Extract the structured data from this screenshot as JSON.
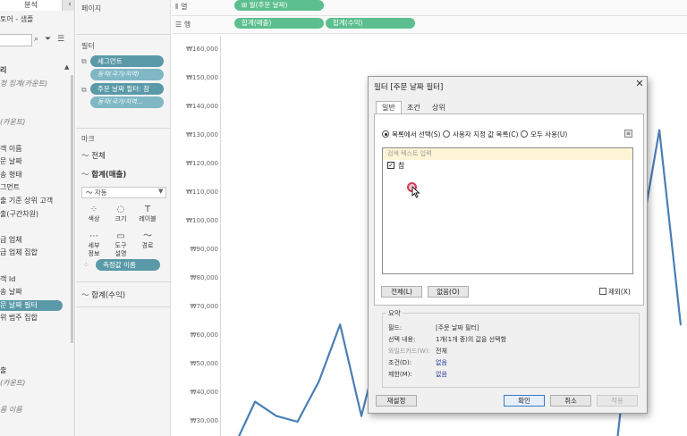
{
  "left_pane": {
    "tab_label": "분석",
    "collapse_icon": "chevron-left-icon",
    "datasource": "토어 - 샘플",
    "fields": [
      {
        "label": "리",
        "style": "bold"
      },
      {
        "label": "정 집계(카운트)",
        "style": "italic"
      },
      {
        "label": "",
        "style": ""
      },
      {
        "label": "",
        "style": ""
      },
      {
        "label": "(카운트)",
        "style": "italic"
      },
      {
        "label": "",
        "style": ""
      },
      {
        "label": "객 이름",
        "style": ""
      },
      {
        "label": "문 날짜",
        "style": ""
      },
      {
        "label": "송 형태",
        "style": ""
      },
      {
        "label": "그먼트",
        "style": ""
      },
      {
        "label": "출 기준 상위 고객",
        "style": ""
      },
      {
        "label": "출(구간차원)",
        "style": ""
      },
      {
        "label": "",
        "style": ""
      },
      {
        "label": "급 업체",
        "style": ""
      },
      {
        "label": "급 업체 집합",
        "style": ""
      },
      {
        "label": "",
        "style": ""
      },
      {
        "label": "객 Id",
        "style": ""
      },
      {
        "label": "송 날짜",
        "style": ""
      },
      {
        "label": "문 날짜 필터",
        "style": "selected"
      },
      {
        "label": "위 범주 집합",
        "style": ""
      },
      {
        "label": "",
        "style": ""
      },
      {
        "label": "",
        "style": ""
      },
      {
        "label": "",
        "style": ""
      },
      {
        "label": "출",
        "style": ""
      },
      {
        "label": "(카운트)",
        "style": "italic"
      },
      {
        "label": "",
        "style": ""
      },
      {
        "label": "름 이름",
        "style": "italic"
      }
    ]
  },
  "cards": {
    "pages_title": "페이지",
    "filters_title": "필터",
    "filter_pills": [
      {
        "label": "세그먼트",
        "sub": "동작(국가/지역)"
      },
      {
        "label": "주문 날짜 필터: 참",
        "sub": "동작(국가/지역..."
      }
    ],
    "marks_title": "마크",
    "marks_all": "전체",
    "marks_measure": "합계(매출)",
    "marks_type": "자동",
    "mark_buttons": [
      {
        "label": "색상",
        "icon": "color-dots-icon",
        "glyph": "⁘"
      },
      {
        "label": "크기",
        "icon": "size-icon",
        "glyph": "◌"
      },
      {
        "label": "레이블",
        "icon": "label-icon",
        "glyph": "T"
      },
      {
        "label": "세부\n정보",
        "icon": "detail-icon",
        "glyph": "⋯"
      },
      {
        "label": "도구\n설명",
        "icon": "tooltip-icon",
        "glyph": "▭"
      },
      {
        "label": "경로",
        "icon": "path-icon",
        "glyph": "〜"
      }
    ],
    "measure_names_pill": "측정값 이름",
    "marks_profit": "합계(수익)"
  },
  "shelves": {
    "columns_label": "열",
    "columns_icon": "columns-icon",
    "columns_pill": "월(주문 날짜)",
    "rows_label": "행",
    "rows_icon": "rows-icon",
    "rows_pills": [
      "합계(매출)",
      "합계(수익)"
    ]
  },
  "chart_data": {
    "type": "line",
    "y_axis_ticks": [
      "₩160,000",
      "₩150,000",
      "₩140,000",
      "₩130,000",
      "₩120,000",
      "₩110,000",
      "₩100,000",
      "₩90,000",
      "₩80,000",
      "₩70,000",
      "₩60,000",
      "₩50,000",
      "₩40,000",
      "₩30,000"
    ],
    "ylim": [
      25000,
      165000
    ],
    "series": [
      {
        "color": "#4a7fb5",
        "visible_segments": [
          {
            "x": [
              0,
              1,
              2,
              3,
              4,
              5,
              6,
              7,
              8,
              9
            ],
            "values": [
              21000,
              37000,
              32000,
              30000,
              44000,
              64000,
              32000,
              61000,
              61000,
              52000
            ]
          },
          {
            "x": [
              18,
              19,
              20,
              21
            ],
            "values": [
              22000,
              89000,
              132000,
              64000
            ]
          }
        ],
        "x_range": [
          -0.6,
          21.3
        ]
      }
    ]
  },
  "dialog": {
    "title": "필터 [주문 날짜 필터]",
    "close_icon": "close-icon",
    "tabs": [
      "일반",
      "조건",
      "상위"
    ],
    "radio_options": [
      "목록에서 선택(S)",
      "사용자 지정 값 목록(C)",
      "모두 사용(U)"
    ],
    "list_options_icon": "list-options-icon",
    "search_placeholder": "검색 텍스트 입력",
    "items": [
      {
        "label": "참",
        "checked": true
      }
    ],
    "check_mark": "✓",
    "all_button": "전체(L)",
    "none_button": "없음(O)",
    "exclude_label": "제외(X)",
    "summary": {
      "title": "요약",
      "rows": [
        {
          "key": "필드:",
          "value": "[주문 날짜 필터]"
        },
        {
          "key": "선택 내용:",
          "value": "1개(1개 중)의 값을 선택함"
        },
        {
          "key": "와일드카드(W):",
          "value": "전체"
        },
        {
          "key": "조건(D):",
          "value": "없음"
        },
        {
          "key": "제한(M):",
          "value": "없음"
        }
      ]
    },
    "reset_button": "재설정",
    "ok_button": "확인",
    "cancel_button": "취소",
    "apply_button": "적용"
  }
}
